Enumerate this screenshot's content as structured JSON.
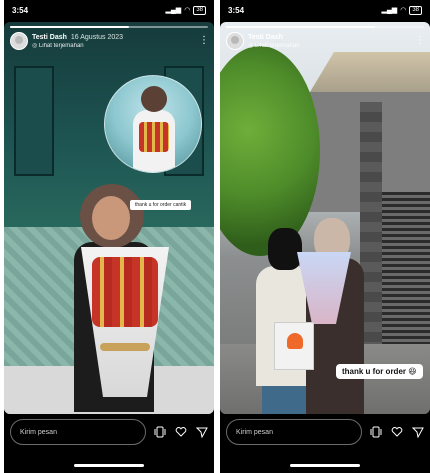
{
  "screens": [
    {
      "status": {
        "time": "3:54",
        "battery": "38"
      },
      "story": {
        "username": "Testi Dash",
        "date": "16 Agustus 2023",
        "translate_label": "Lihat terjemahan",
        "sticker_caption": "thank u for order cantik"
      },
      "reply_placeholder": "Kirim pesan"
    },
    {
      "status": {
        "time": "3:54",
        "battery": "38"
      },
      "story": {
        "username": "Testi Dash",
        "date": "",
        "translate_label": "Lihat terjemahan",
        "sticker_caption": "thank u for order 😆"
      },
      "reply_placeholder": "Kirim pesan"
    }
  ],
  "icons": {
    "pages": "pages-icon",
    "like": "heart-icon",
    "send": "send-icon"
  },
  "colors": {
    "background": "#000000",
    "text": "#ffffff"
  }
}
